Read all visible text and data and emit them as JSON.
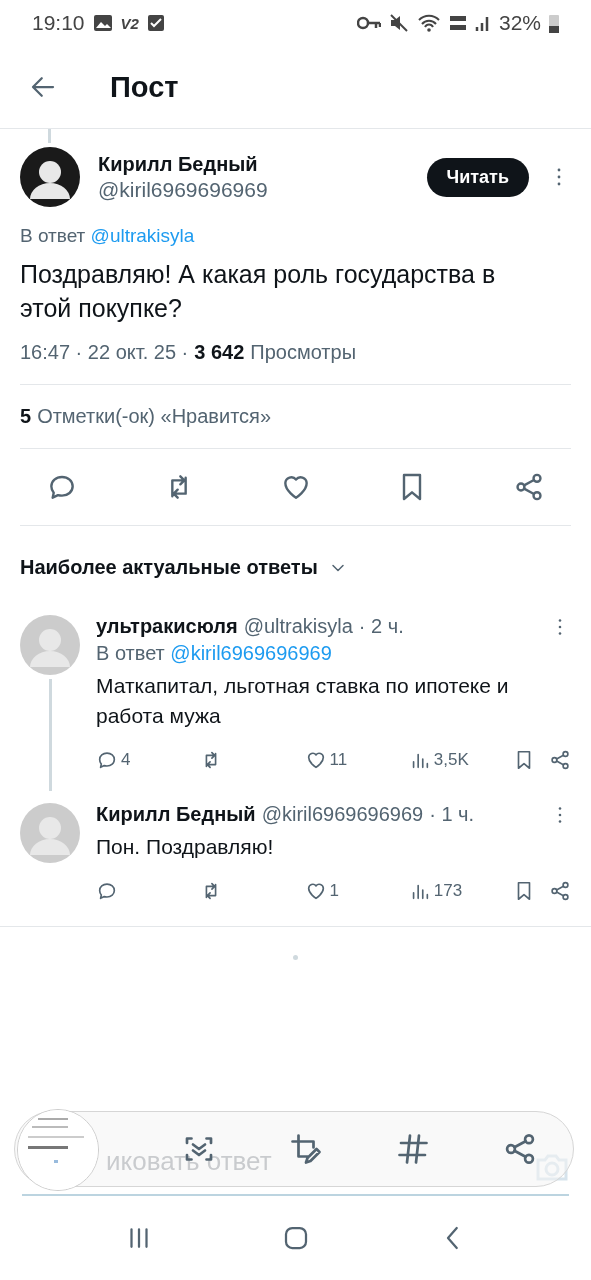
{
  "status_bar": {
    "time": "19:10",
    "left_badge": "V2",
    "battery": "32%"
  },
  "header": {
    "title": "Пост"
  },
  "post": {
    "author": "Кирилл Бедный",
    "handle": "@kiril6969696969",
    "follow_button": "Читать",
    "reply_to_label": "В ответ",
    "reply_to_handle": "@ultrakisyla",
    "text": "Поздравляю! А какая роль государства в этой покупке?",
    "timestamp": "16:47 · 22 окт. 25 ·",
    "views_count": "3 642",
    "views_label": "Просмотры",
    "likes_count": "5",
    "likes_label": "Отметки(-ок) «Нравится»"
  },
  "replies_sort": "Наиболее актуальные ответы",
  "replies": [
    {
      "name": "ультракисюля",
      "handle": "@ultrakisyla",
      "time": "· 2 ч.",
      "reply_to_label": "В ответ",
      "reply_to_handle": "@kiril6969696969",
      "text": "Маткапитал, льготная ставка по ипотеке и работа мужа",
      "reply_count": "4",
      "like_count": "11",
      "view_count": "3,5K",
      "thread_line": true
    },
    {
      "name": "Кирилл Бедный",
      "handle": "@kiril6969696969",
      "time": "· 1 ч.",
      "text": "Пон. Поздравляю!",
      "like_count": "1",
      "view_count": "173",
      "thread_line": false
    }
  ],
  "reply_field": {
    "placeholder": "иковать ответ"
  }
}
